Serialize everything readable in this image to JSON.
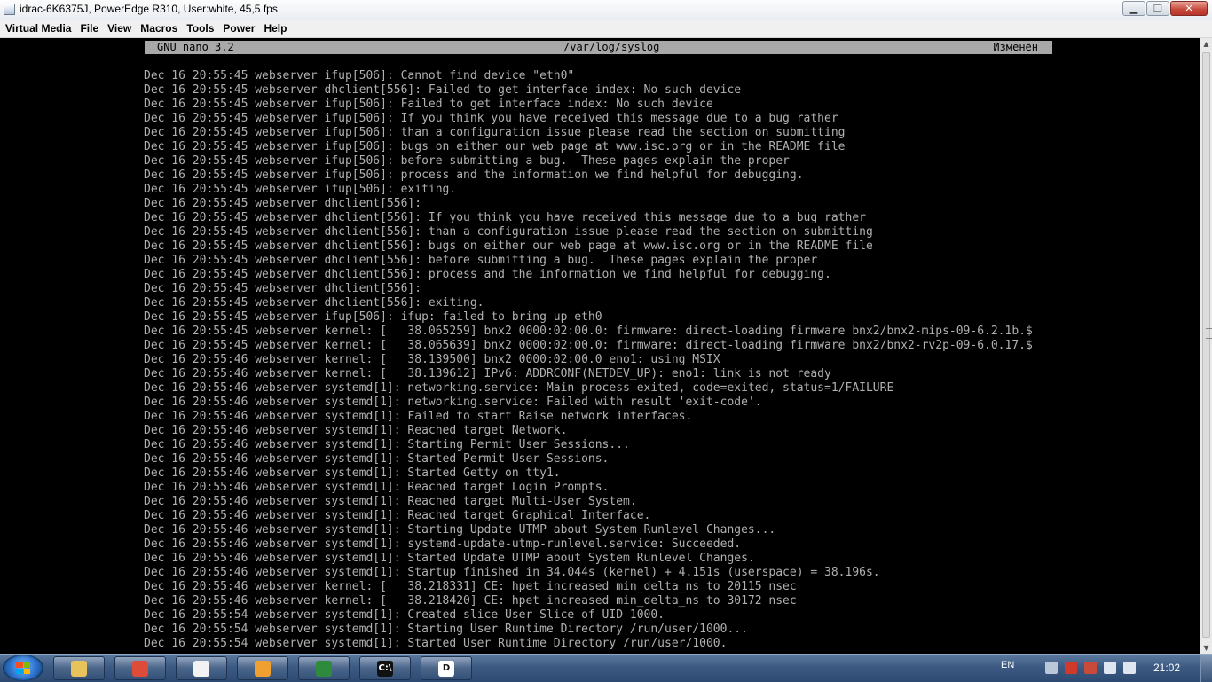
{
  "window": {
    "title": "idrac-6K6375J, PowerEdge R310, User:white, 45,5 fps",
    "controls": {
      "minimize": "▁",
      "maximize": "❐",
      "close": "✕"
    }
  },
  "menu": [
    "Virtual Media",
    "File",
    "View",
    "Macros",
    "Tools",
    "Power",
    "Help"
  ],
  "nano": {
    "version": "GNU nano 3.2",
    "filename": "/var/log/syslog",
    "status": "Изменён"
  },
  "log_lines": [
    "Dec 16 20:55:45 webserver ifup[506]: Cannot find device \"eth0\"",
    "Dec 16 20:55:45 webserver dhclient[556]: Failed to get interface index: No such device",
    "Dec 16 20:55:45 webserver ifup[506]: Failed to get interface index: No such device",
    "Dec 16 20:55:45 webserver ifup[506]: If you think you have received this message due to a bug rather",
    "Dec 16 20:55:45 webserver ifup[506]: than a configuration issue please read the section on submitting",
    "Dec 16 20:55:45 webserver ifup[506]: bugs on either our web page at www.isc.org or in the README file",
    "Dec 16 20:55:45 webserver ifup[506]: before submitting a bug.  These pages explain the proper",
    "Dec 16 20:55:45 webserver ifup[506]: process and the information we find helpful for debugging.",
    "Dec 16 20:55:45 webserver ifup[506]: exiting.",
    "Dec 16 20:55:45 webserver dhclient[556]:",
    "Dec 16 20:55:45 webserver dhclient[556]: If you think you have received this message due to a bug rather",
    "Dec 16 20:55:45 webserver dhclient[556]: than a configuration issue please read the section on submitting",
    "Dec 16 20:55:45 webserver dhclient[556]: bugs on either our web page at www.isc.org or in the README file",
    "Dec 16 20:55:45 webserver dhclient[556]: before submitting a bug.  These pages explain the proper",
    "Dec 16 20:55:45 webserver dhclient[556]: process and the information we find helpful for debugging.",
    "Dec 16 20:55:45 webserver dhclient[556]:",
    "Dec 16 20:55:45 webserver dhclient[556]: exiting.",
    "Dec 16 20:55:45 webserver ifup[506]: ifup: failed to bring up eth0",
    "Dec 16 20:55:45 webserver kernel: [   38.065259] bnx2 0000:02:00.0: firmware: direct-loading firmware bnx2/bnx2-mips-09-6.2.1b.$",
    "Dec 16 20:55:45 webserver kernel: [   38.065639] bnx2 0000:02:00.0: firmware: direct-loading firmware bnx2/bnx2-rv2p-09-6.0.17.$",
    "Dec 16 20:55:46 webserver kernel: [   38.139500] bnx2 0000:02:00.0 eno1: using MSIX",
    "Dec 16 20:55:46 webserver kernel: [   38.139612] IPv6: ADDRCONF(NETDEV_UP): eno1: link is not ready",
    "Dec 16 20:55:46 webserver systemd[1]: networking.service: Main process exited, code=exited, status=1/FAILURE",
    "Dec 16 20:55:46 webserver systemd[1]: networking.service: Failed with result 'exit-code'.",
    "Dec 16 20:55:46 webserver systemd[1]: Failed to start Raise network interfaces.",
    "Dec 16 20:55:46 webserver systemd[1]: Reached target Network.",
    "Dec 16 20:55:46 webserver systemd[1]: Starting Permit User Sessions...",
    "Dec 16 20:55:46 webserver systemd[1]: Started Permit User Sessions.",
    "Dec 16 20:55:46 webserver systemd[1]: Started Getty on tty1.",
    "Dec 16 20:55:46 webserver systemd[1]: Reached target Login Prompts.",
    "Dec 16 20:55:46 webserver systemd[1]: Reached target Multi-User System.",
    "Dec 16 20:55:46 webserver systemd[1]: Reached target Graphical Interface.",
    "Dec 16 20:55:46 webserver systemd[1]: Starting Update UTMP about System Runlevel Changes...",
    "Dec 16 20:55:46 webserver systemd[1]: systemd-update-utmp-runlevel.service: Succeeded.",
    "Dec 16 20:55:46 webserver systemd[1]: Started Update UTMP about System Runlevel Changes.",
    "Dec 16 20:55:46 webserver systemd[1]: Startup finished in 34.044s (kernel) + 4.151s (userspace) = 38.196s.",
    "Dec 16 20:55:46 webserver kernel: [   38.218331] CE: hpet increased min_delta_ns to 20115 nsec",
    "Dec 16 20:55:46 webserver kernel: [   38.218420] CE: hpet increased min_delta_ns to 30172 nsec",
    "Dec 16 20:55:54 webserver systemd[1]: Created slice User Slice of UID 1000.",
    "Dec 16 20:55:54 webserver systemd[1]: Starting User Runtime Directory /run/user/1000...",
    "Dec 16 20:55:54 webserver systemd[1]: Started User Runtime Directory /run/user/1000."
  ],
  "taskbar": {
    "apps": [
      {
        "name": "explorer-icon",
        "color": "#e8c25a"
      },
      {
        "name": "chrome-icon",
        "color": "#dd4b39"
      },
      {
        "name": "notepad-icon",
        "color": "#f2f2f2"
      },
      {
        "name": "paint-icon",
        "color": "#f0a030"
      },
      {
        "name": "spreadsheet-icon",
        "color": "#2e8b3e"
      },
      {
        "name": "cmd-icon",
        "color": "#111111",
        "glyph": "C:\\"
      },
      {
        "name": "console-app-icon",
        "color": "#ffffff",
        "glyph": "D"
      }
    ],
    "language": "EN",
    "clock": "21:02"
  }
}
